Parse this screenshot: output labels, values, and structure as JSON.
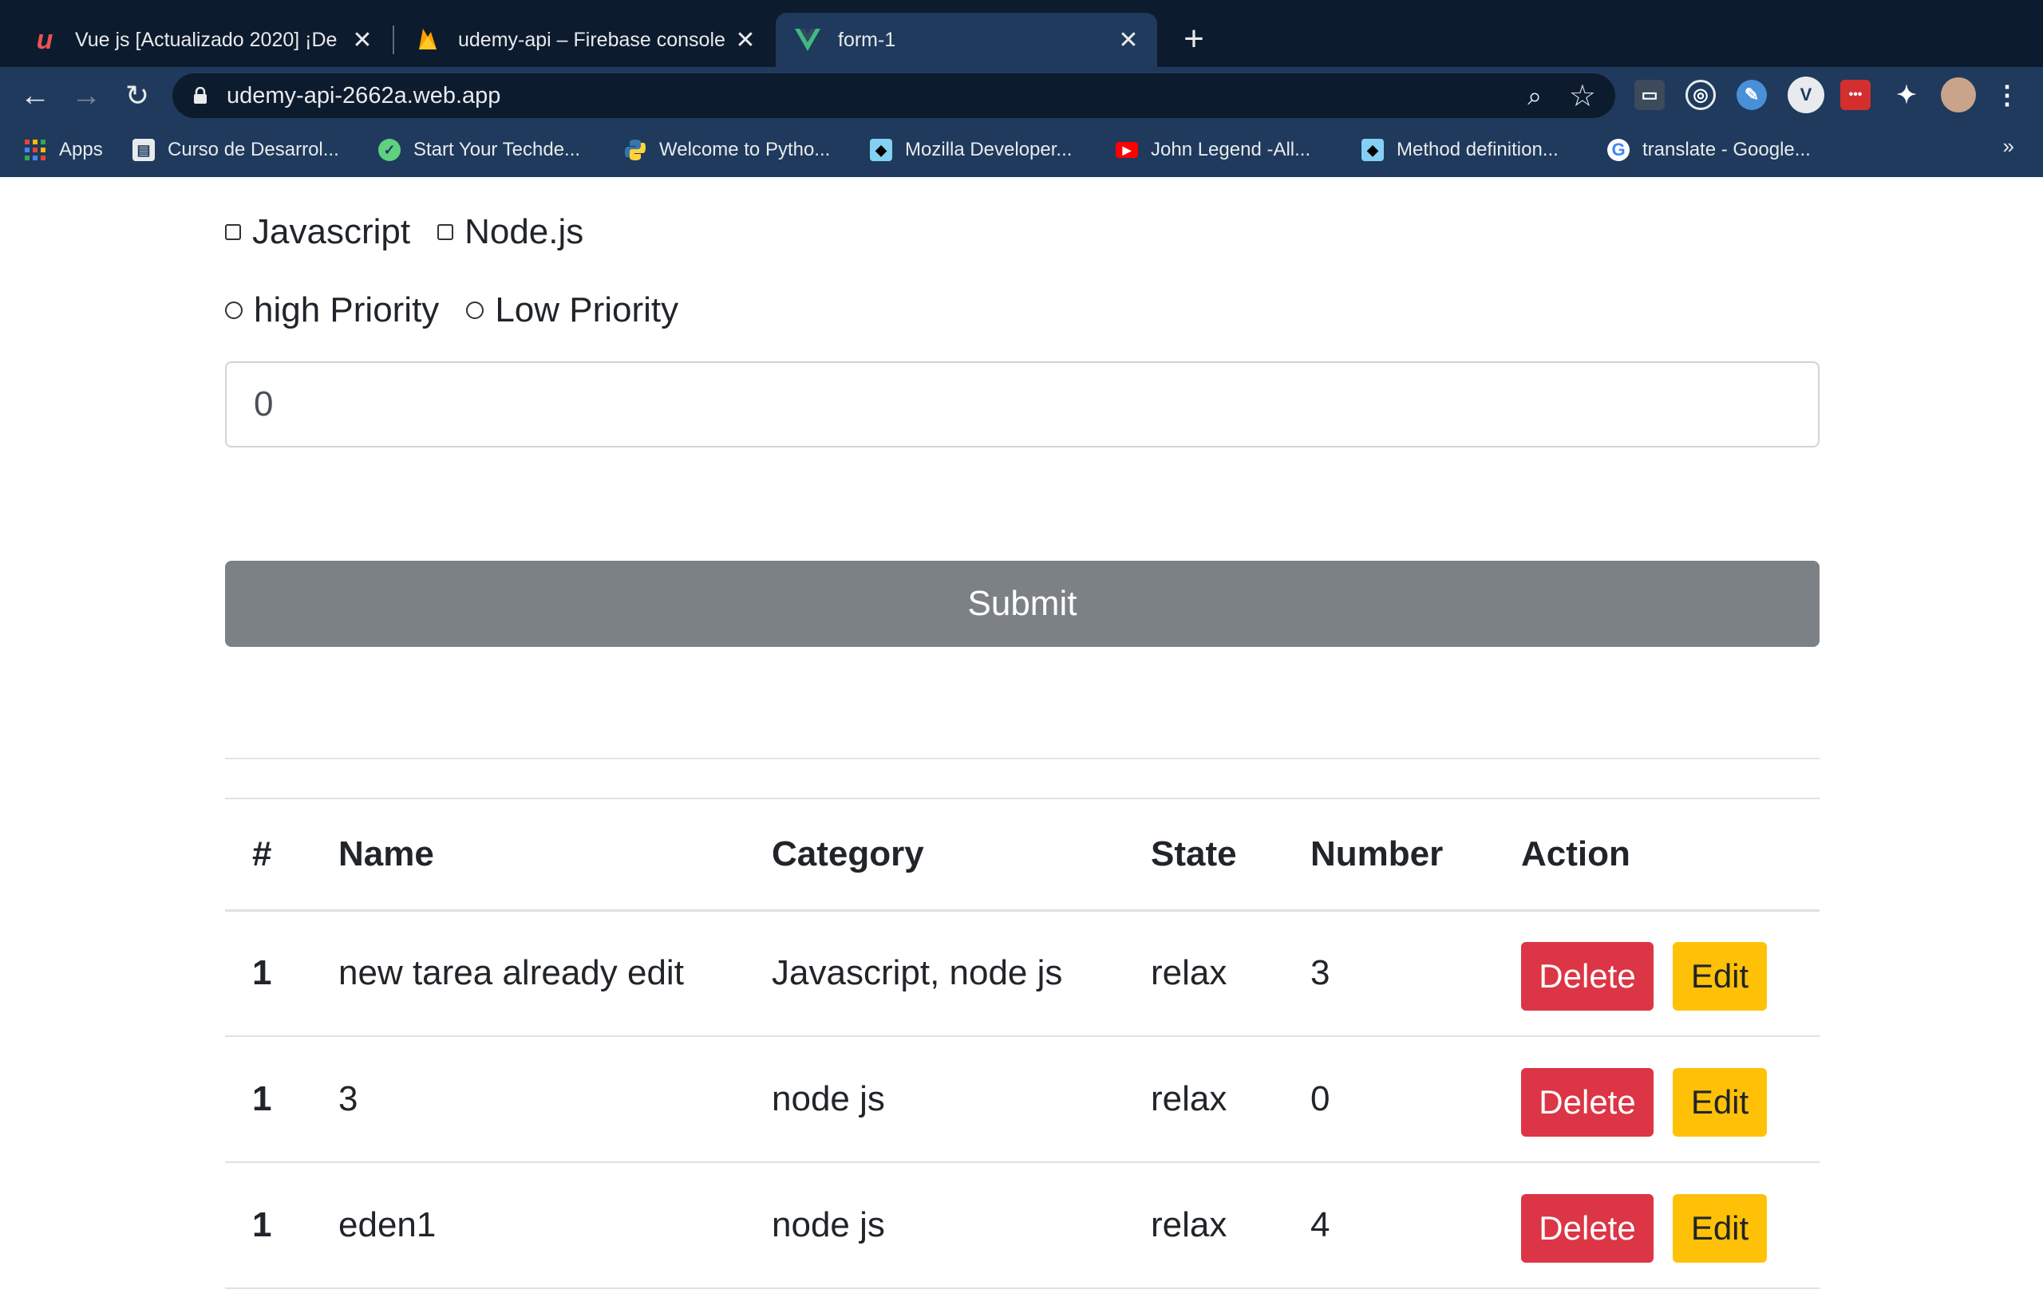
{
  "browser": {
    "tabs": [
      {
        "title": "Vue js [Actualizado 2020] ¡De ",
        "icon": "udemy-icon",
        "active": false
      },
      {
        "title": "udemy-api – Firebase console",
        "icon": "firebase-icon",
        "active": false
      },
      {
        "title": "form-1",
        "icon": "vue-icon",
        "active": true
      }
    ],
    "close_glyph": "✕",
    "new_tab_glyph": "+",
    "url": "udemy-api-2662a.web.app",
    "bookmarks": [
      {
        "label": "Apps",
        "icon": "apps-grid-icon"
      },
      {
        "label": "Curso de Desarrol...",
        "icon": "briefcase-icon"
      },
      {
        "label": "Start Your Techde...",
        "icon": "techdegree-icon"
      },
      {
        "label": "Welcome to Pytho...",
        "icon": "python-icon"
      },
      {
        "label": "Mozilla Developer...",
        "icon": "mdn-icon"
      },
      {
        "label": "John Legend -All...",
        "icon": "youtube-icon"
      },
      {
        "label": "Method definition...",
        "icon": "mdn-icon"
      },
      {
        "label": "translate - Google...",
        "icon": "google-icon"
      }
    ],
    "bookmarks_more": "»"
  },
  "form": {
    "checkboxes": [
      "Javascript",
      "Node.js"
    ],
    "radios": [
      "high Priority",
      "Low Priority"
    ],
    "number_value": "0",
    "submit_label": "Submit"
  },
  "table": {
    "headers": [
      "#",
      "Name",
      "Category",
      "State",
      "Number",
      "Action"
    ],
    "rows": [
      {
        "index": "1",
        "name": "new tarea already edit",
        "category": "Javascript, node js",
        "state": "relax",
        "number": "3"
      },
      {
        "index": "1",
        "name": "3",
        "category": "node js",
        "state": "relax",
        "number": "0"
      },
      {
        "index": "1",
        "name": "eden1",
        "category": "node js",
        "state": "relax",
        "number": "4"
      }
    ],
    "delete_label": "Delete",
    "edit_label": "Edit"
  },
  "colors": {
    "delete": "#dc3545",
    "edit": "#ffc107",
    "submit": "#7c8185"
  }
}
